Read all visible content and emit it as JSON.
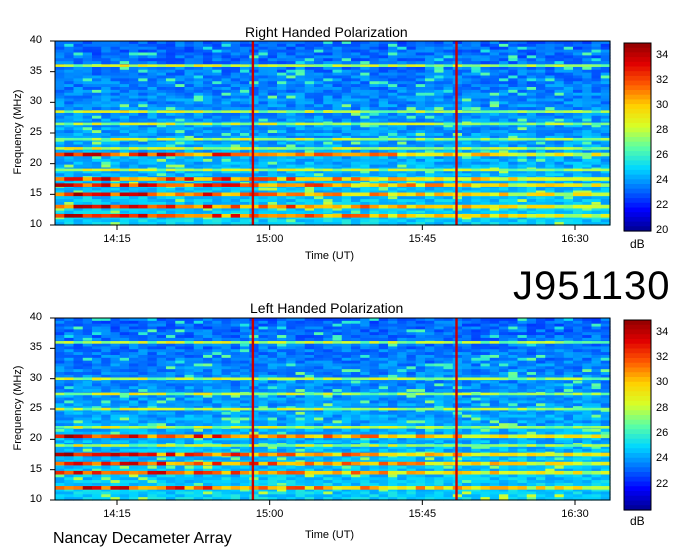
{
  "observation_id": "J951130",
  "footer_label": "Nancay Decameter Array",
  "colors": {
    "colormap": [
      "#00008f",
      "#0000ff",
      "#0070ff",
      "#00d8ff",
      "#5cffa3",
      "#d8ff27",
      "#ffd000",
      "#ff5a00",
      "#e00000",
      "#8f0000"
    ]
  },
  "chart_data": [
    {
      "type": "heatmap",
      "title": "Right Handed Polarization",
      "xlabel": "Time (UT)",
      "ylabel": "Frequency (MHz)",
      "x_ticks": [
        "14:15",
        "15:00",
        "15:45",
        "16:30"
      ],
      "y_ticks": [
        "10",
        "15",
        "20",
        "25",
        "30",
        "35",
        "40"
      ],
      "ylim": [
        10,
        40
      ],
      "colorbar": {
        "unit": "dB",
        "range": [
          20,
          35
        ],
        "ticks": [
          "20",
          "22",
          "24",
          "26",
          "28",
          "30",
          "32",
          "34"
        ]
      },
      "strong_bands_mhz": [
        11.5,
        13,
        15,
        16.5,
        17.5,
        21.5
      ],
      "moderate_bands_mhz": [
        19,
        22.5,
        24,
        26.5,
        28.5,
        36
      ],
      "vertical_lines_ut": [
        "14:55",
        "15:55"
      ]
    },
    {
      "type": "heatmap",
      "title": "Left Handed Polarization",
      "xlabel": "Time (UT)",
      "ylabel": "Frequency (MHz)",
      "x_ticks": [
        "14:15",
        "15:00",
        "15:45",
        "16:30"
      ],
      "y_ticks": [
        "10",
        "15",
        "20",
        "25",
        "30",
        "35",
        "40"
      ],
      "ylim": [
        10,
        40
      ],
      "colorbar": {
        "unit": "dB",
        "range": [
          20,
          35
        ],
        "ticks": [
          "22",
          "24",
          "26",
          "28",
          "30",
          "32",
          "34"
        ]
      },
      "strong_bands_mhz": [
        12,
        14.5,
        16,
        17.5,
        20.5
      ],
      "moderate_bands_mhz": [
        19,
        22,
        25,
        27.5,
        30,
        36
      ],
      "vertical_lines_ut": [
        "14:55",
        "15:55"
      ]
    }
  ]
}
